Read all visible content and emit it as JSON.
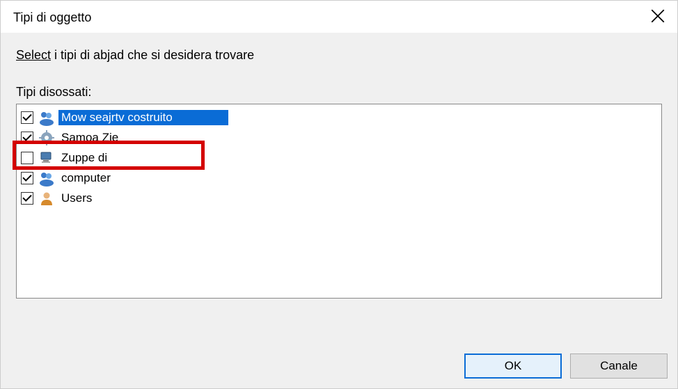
{
  "title": "Tipi di oggetto",
  "instruction_prefix": "Select",
  "instruction_rest": " i tipi di abjad che si desidera trovare",
  "list_label": "Tipi disossati:",
  "items": [
    {
      "label": "Mow seajrtv costruito",
      "checked": true,
      "selected": true,
      "icon": "people"
    },
    {
      "label": "Samoa Zie",
      "checked": true,
      "selected": false,
      "icon": "gear"
    },
    {
      "label": "Zuppe di",
      "checked": false,
      "selected": false,
      "icon": "computer"
    },
    {
      "label": "computer",
      "checked": true,
      "selected": false,
      "icon": "people2"
    },
    {
      "label": "Users",
      "checked": true,
      "selected": false,
      "icon": "user"
    }
  ],
  "buttons": {
    "ok": "OK",
    "cancel": "Canale"
  }
}
